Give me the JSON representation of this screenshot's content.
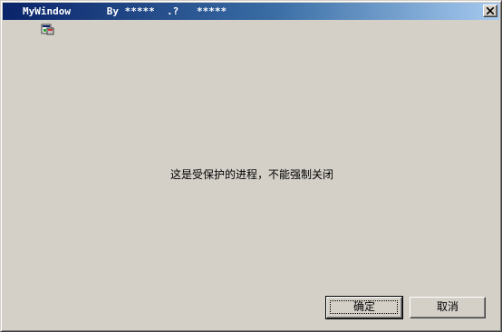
{
  "window": {
    "title": "MyWindow      By *****  .?   *****"
  },
  "message": "这是受保护的进程，不能强制关闭",
  "buttons": {
    "ok_label": "确定",
    "cancel_label": "取消"
  },
  "icons": {
    "app": "app-window-icon",
    "close": "close-x-icon"
  },
  "colors": {
    "titlebar_start": "#0a246a",
    "titlebar_end": "#a6caf0",
    "face": "#d4d0c8"
  }
}
